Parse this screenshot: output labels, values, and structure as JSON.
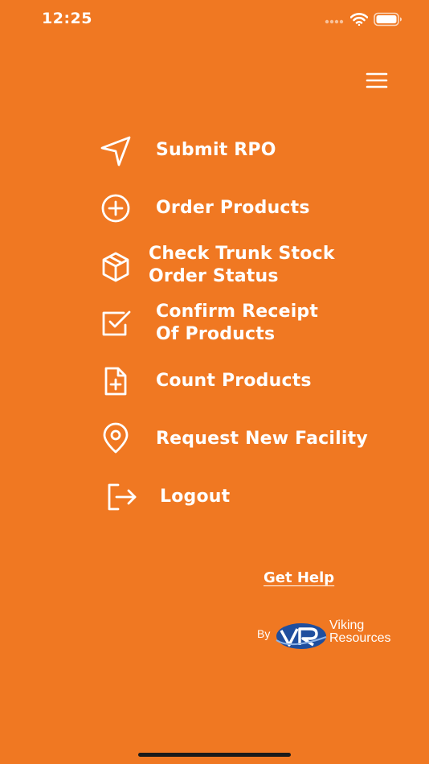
{
  "status_bar": {
    "time": "12:25"
  },
  "header": {
    "menu_icon": "hamburger-menu-icon"
  },
  "menu": {
    "items": [
      {
        "label": "Submit RPO",
        "icon": "send-arrow-icon"
      },
      {
        "label": "Order Products",
        "icon": "plus-circle-icon"
      },
      {
        "label": "Check Trunk Stock\nOrder Status",
        "icon": "box-icon"
      },
      {
        "label": "Confirm Receipt\nOf Products",
        "icon": "checkbox-icon"
      },
      {
        "label": "Count Products",
        "icon": "file-plus-icon"
      },
      {
        "label": "Request New Facility",
        "icon": "map-pin-icon"
      },
      {
        "label": "Logout",
        "icon": "logout-icon"
      }
    ]
  },
  "footer": {
    "help_label": "Get Help",
    "by_label": "By",
    "company_name": "Viking\nResources"
  },
  "colors": {
    "background": "#F07822",
    "foreground": "#FFFFFF",
    "logo_blue": "#1F4E9E"
  }
}
